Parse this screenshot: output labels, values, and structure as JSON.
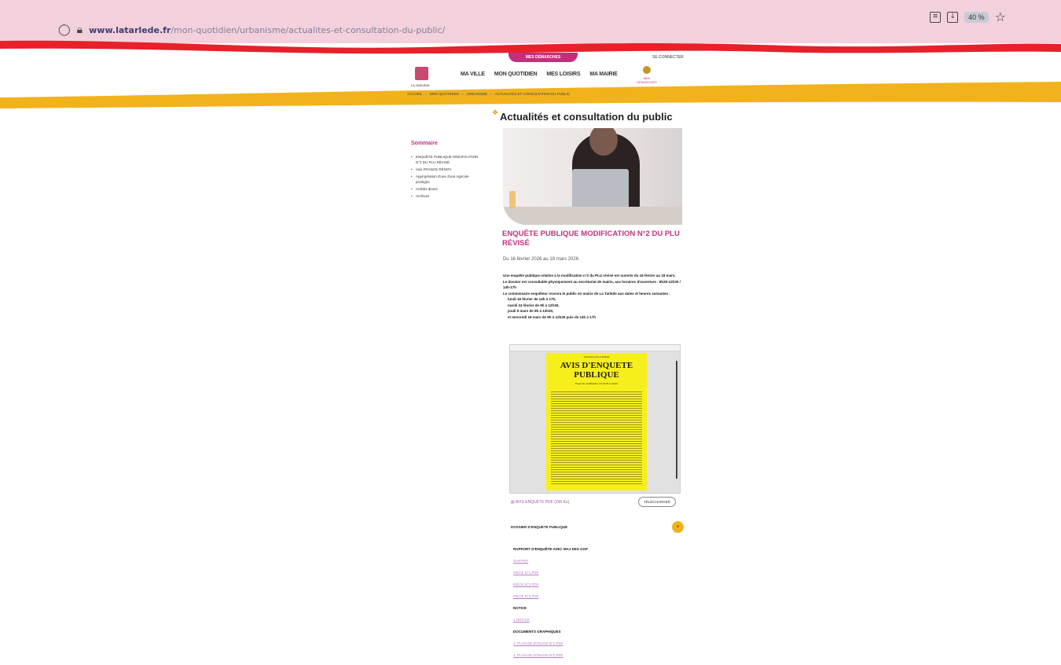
{
  "browser": {
    "url_domain": "www.latarlede.fr",
    "url_path": "/mon-quotidien/urbanisme/actualites-et-consultation-du-public/",
    "zoom": "40 %"
  },
  "header": {
    "top_pill": "MES DÉMARCHES",
    "login": "SE CONNECTER",
    "logo_text": "LA TARLEDE",
    "nav": [
      "MA VILLE",
      "MON QUOTIDIEN",
      "MES LOISIRS",
      "MA MAIRIE"
    ],
    "nav_extra": "MES DÉMARCHES"
  },
  "breadcrumb": [
    "ACCUEIL",
    "MON QUOTIDIEN",
    "URBANISME",
    "ACTUALITÉS ET CONSULTATION DU PUBLIC"
  ],
  "page_title": "Actualités et consultation du public",
  "sidebar": {
    "title": "Sommaire",
    "items": [
      "ENQUÊTE PUBLIQUE MODIFICATION N°2 DU PLU RÉVISÉ",
      "Avis FRANCE RENOV",
      "Appropriation d'une Zone Agricole protégée",
      "Arrêtés divers",
      "Archives"
    ]
  },
  "article": {
    "title": "ENQUÊTE PUBLIQUE MODIFICATION N°2 DU PLU RÉVISÉ",
    "date": "Du 16 février 2026 au 18 mars 2026",
    "body": [
      "Une enquête publique relative à la modification n°2 du PLU révisé est ouverte du 16 février au 18 mars.",
      "Le dossier est consultable physiquement au secrétariat de mairie, aux horaires d'ouverture : 8h30-12h30 / 14h-17h",
      "Le commissaire enquêteur recevra le public en mairie de La Tarlède aux dates et heures suivantes :"
    ],
    "permanences": [
      "lundi 16 février de 14h à 17h,",
      "mardi 24 février de 9h à 12h30,",
      "jeudi 5 mars de 9h à 12h30,",
      "et mercredi 18 mars de 9h à 12h30 puis de 14h à 17h"
    ],
    "document": {
      "header": "Commune de La Tarlède",
      "heading": "AVIS D'ENQUETE PUBLIQUE",
      "sub": "Projet de modification n°2 du PLU révisé"
    },
    "download_link": "AVIS ENQUETE PDF",
    "download_size": "(245 Ko)",
    "download_btn": "TÉLÉCHARGER",
    "accordion_label": "DOSSIER D'ENQUETE PUBLIQUE",
    "accordion_icon": "+",
    "files": [
      {
        "type": "heading",
        "text": "RAPPORT D'ENQUÊTE AVEC MAJ DES OAP"
      },
      {
        "type": "link",
        "text": "OAP.PDF"
      },
      {
        "type": "link",
        "text": "PIÈCE N°1.PDF"
      },
      {
        "type": "link",
        "text": "PIÈCE N°2.PDF"
      },
      {
        "type": "link",
        "text": "PIÈCE N°3.PDF"
      },
      {
        "type": "heading",
        "text": "NOTICE"
      },
      {
        "type": "link",
        "text": "1.NOTICE"
      },
      {
        "type": "heading",
        "text": "DOCUMENTS GRAPHIQUES"
      },
      {
        "type": "link",
        "text": "4. PLAN DE ZONAGE N°1.PDF"
      },
      {
        "type": "link",
        "text": "4. PLAN DE ZONAGE N°2.PDF"
      }
    ]
  },
  "colors": {
    "browser_bg": "#f3d1dc",
    "stripe_red": "#e8202a",
    "band_yellow": "#f2b21c",
    "accent_pink": "#c2307c",
    "link_purple": "#b57cc4"
  }
}
